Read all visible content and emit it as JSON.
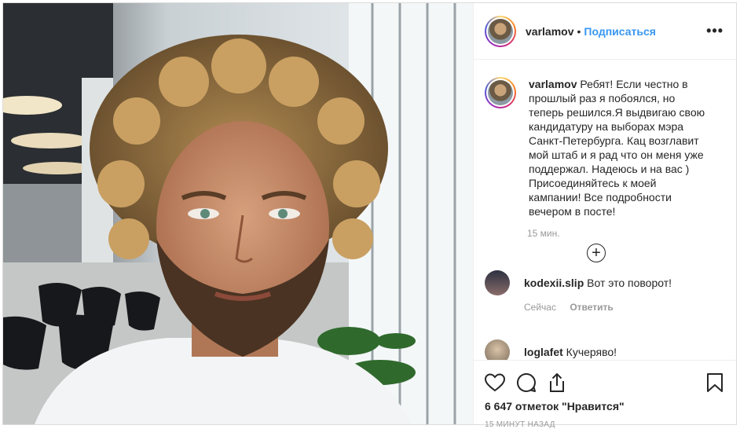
{
  "post": {
    "username": "varlamov",
    "separator": "•",
    "follow_label": "Подписаться",
    "more_label": "•••",
    "caption_user": "varlamov",
    "caption_text": "Ребят! Если честно в прошлый раз я побоялся, но теперь решился.Я выдвигаю свою кандидатуру на выборах мэра Санкт-Петербурга. Кац возглавит мой штаб и я рад что он меня уже поддержал. Надеюсь и на вас ) Присоединяйтесь к моей кампании! Все подробности вечером в посте!",
    "caption_time": "15 мин.",
    "load_more_label": "+",
    "comments": [
      {
        "user": "kodexii.slip",
        "text": "Вот это поворот!",
        "time": "Сейчас",
        "reply": "Ответить"
      },
      {
        "user": "loglafet",
        "text": "Кучеряво!"
      }
    ],
    "likes": "6 647 отметок \"Нравится\"",
    "posted_ago": "15 минут назад"
  },
  "icons": [
    "like-icon",
    "comment-icon",
    "share-icon",
    "bookmark-icon",
    "load-more-icon"
  ],
  "colors": {
    "link": "#3897f0",
    "muted": "#999999",
    "border": "#dbdbdb"
  }
}
